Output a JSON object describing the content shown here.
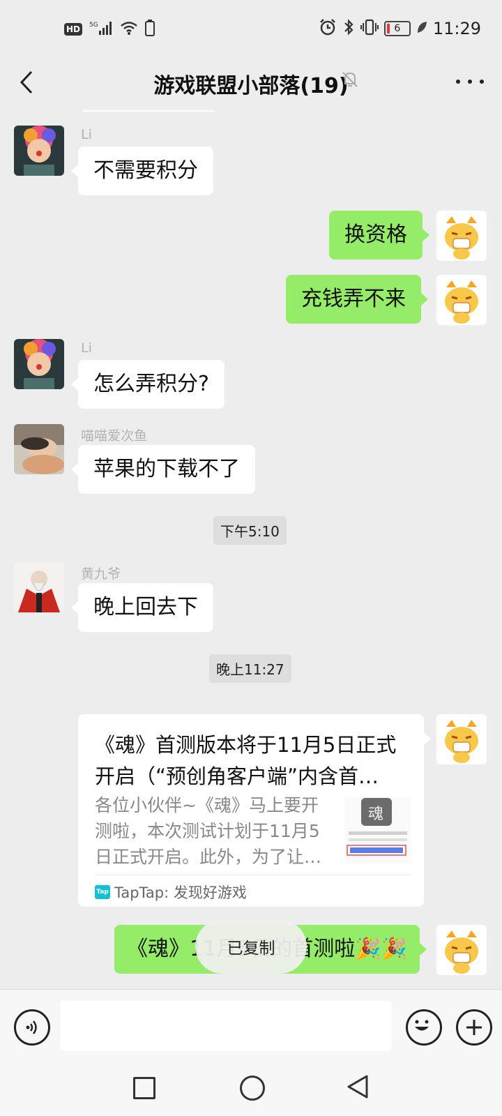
{
  "status_bar": {
    "hd_label": "HD",
    "network_label": "5G",
    "battery_level": "6",
    "time": "11:29"
  },
  "header": {
    "title": "游戏联盟小部落(19)"
  },
  "messages": [
    {
      "sender": "Li",
      "text": "不需要积分"
    },
    {
      "text": "换资格"
    },
    {
      "text": "充钱弄不来"
    },
    {
      "sender": "Li",
      "text": "怎么弄积分?"
    },
    {
      "sender": "喵喵爱次鱼",
      "text": "苹果的下载不了"
    },
    {
      "sender": "黄九爷",
      "text": "晚上回去下"
    },
    {
      "text": "《魂》11月5日的首测啦🎉🎉"
    }
  ],
  "time_labels": [
    "下午5:10",
    "晚上11:27"
  ],
  "link_card": {
    "title": "《魂》首测版本将于11月5日正式开启（“预创角客户端”内含首…",
    "description": "各位小伙伴~《魂》马上要开测啦，本次测试计划于11月5日正式开启。此外，为了让…",
    "source_logo": "Tap",
    "source": "TapTap: 发现好游戏",
    "thumbnail_char": "魂"
  },
  "toast": "已复制",
  "input_bar": {
    "placeholder": ""
  },
  "colors": {
    "outgoing_bubble": "#95ec69",
    "incoming_bubble": "#ffffff",
    "chat_background": "#ededed"
  }
}
